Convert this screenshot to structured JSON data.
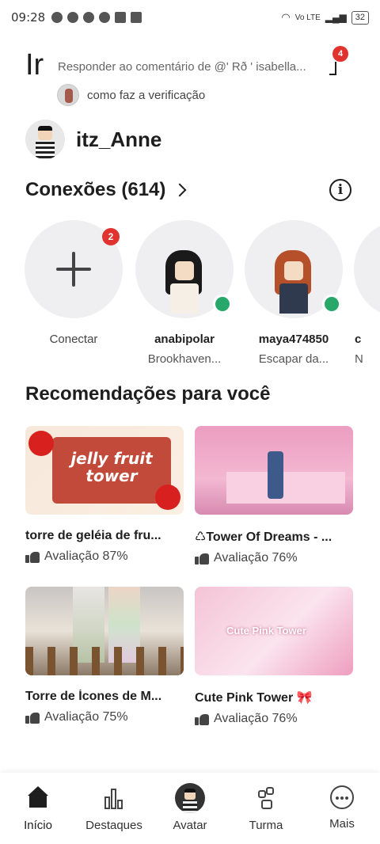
{
  "status_bar": {
    "time": "09:28",
    "network": "Vo LTE",
    "battery": "32"
  },
  "header": {
    "title": "Ir",
    "notification_preview": "Responder ao comentário de @' Rð ' isabella...",
    "notification_count": "4",
    "sub_notification": "como faz a verificação"
  },
  "profile": {
    "username": "itz_Anne"
  },
  "connections": {
    "title": "Conexões (614)",
    "info_icon": "i",
    "connect_label": "Conectar",
    "connect_badge": "2",
    "friends": [
      {
        "name": "anabipolar",
        "status": "Brookhaven...",
        "online": true
      },
      {
        "name": "maya474850",
        "status": "Escapar da...",
        "online": true
      },
      {
        "name": "c",
        "status": "N",
        "online": false
      }
    ]
  },
  "recommendations": {
    "title": "Recomendações para você",
    "thumb_text_1": "jelly fruit tower",
    "thumb_text_4": "Cute Pink Tower",
    "games": [
      {
        "name": "torre de geléia de fru...",
        "rating": "Avaliação 87%"
      },
      {
        "name": "♺Tower Of Dreams - ...",
        "rating": "Avaliação 76%"
      },
      {
        "name": "Torre de Ícones de M...",
        "rating": "Avaliação 75%"
      },
      {
        "name": "Cute Pink Tower 🎀",
        "rating": "Avaliação 76%"
      }
    ]
  },
  "bottom_nav": {
    "items": [
      {
        "label": "Início",
        "icon": "home-icon",
        "active": true
      },
      {
        "label": "Destaques",
        "icon": "chart-icon",
        "active": false
      },
      {
        "label": "Avatar",
        "icon": "avatar-icon",
        "active": false
      },
      {
        "label": "Turma",
        "icon": "group-icon",
        "active": false
      },
      {
        "label": "Mais",
        "icon": "more-icon",
        "active": false
      }
    ]
  },
  "colors": {
    "badge": "#e0322f",
    "online": "#27a86a",
    "text": "#1e1e1e"
  }
}
